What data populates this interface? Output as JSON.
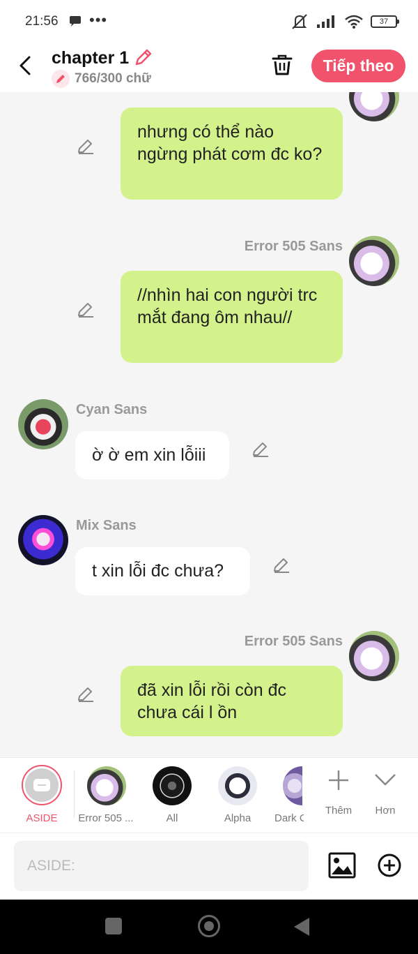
{
  "status_bar": {
    "time": "21:56",
    "dots": "•••",
    "battery": "37"
  },
  "header": {
    "title": "chapter 1",
    "word_count": "766/300 chữ",
    "next_button": "Tiếp theo"
  },
  "messages": [
    {
      "side": "right",
      "sender": "",
      "text": "nhưng có thể nào ngừng phát cơm đc ko?"
    },
    {
      "side": "right",
      "sender": "Error 505 Sans",
      "text": "//nhìn hai con người trc mắt đang ôm nhau//"
    },
    {
      "side": "left",
      "sender": "Cyan Sans",
      "text": "ờ ờ em xin lỗiii"
    },
    {
      "side": "left",
      "sender": "Mix Sans",
      "text": "t xin lỗi đc chưa?"
    },
    {
      "side": "right",
      "sender": "Error 505 Sans",
      "text": "đã xin lỗi rồi còn đc chưa cái l ồn"
    }
  ],
  "characters": [
    {
      "label": "ASIDE",
      "active": true
    },
    {
      "label": "Error 505 ..."
    },
    {
      "label": "All"
    },
    {
      "label": "Alpha"
    },
    {
      "label": "Dark C"
    }
  ],
  "tools": {
    "add_label": "Thêm",
    "more_label": "Hơn"
  },
  "input": {
    "placeholder": "ASIDE:"
  },
  "colors": {
    "accent": "#f0536b",
    "my_bubble": "#d4f28c",
    "other_bubble": "#ffffff",
    "background": "#f5f5f5"
  },
  "icons": [
    "back-arrow-icon",
    "edit-pencil-icon",
    "trash-icon",
    "image-icon",
    "add-circle-icon",
    "plus-icon",
    "chevron-down-icon"
  ]
}
